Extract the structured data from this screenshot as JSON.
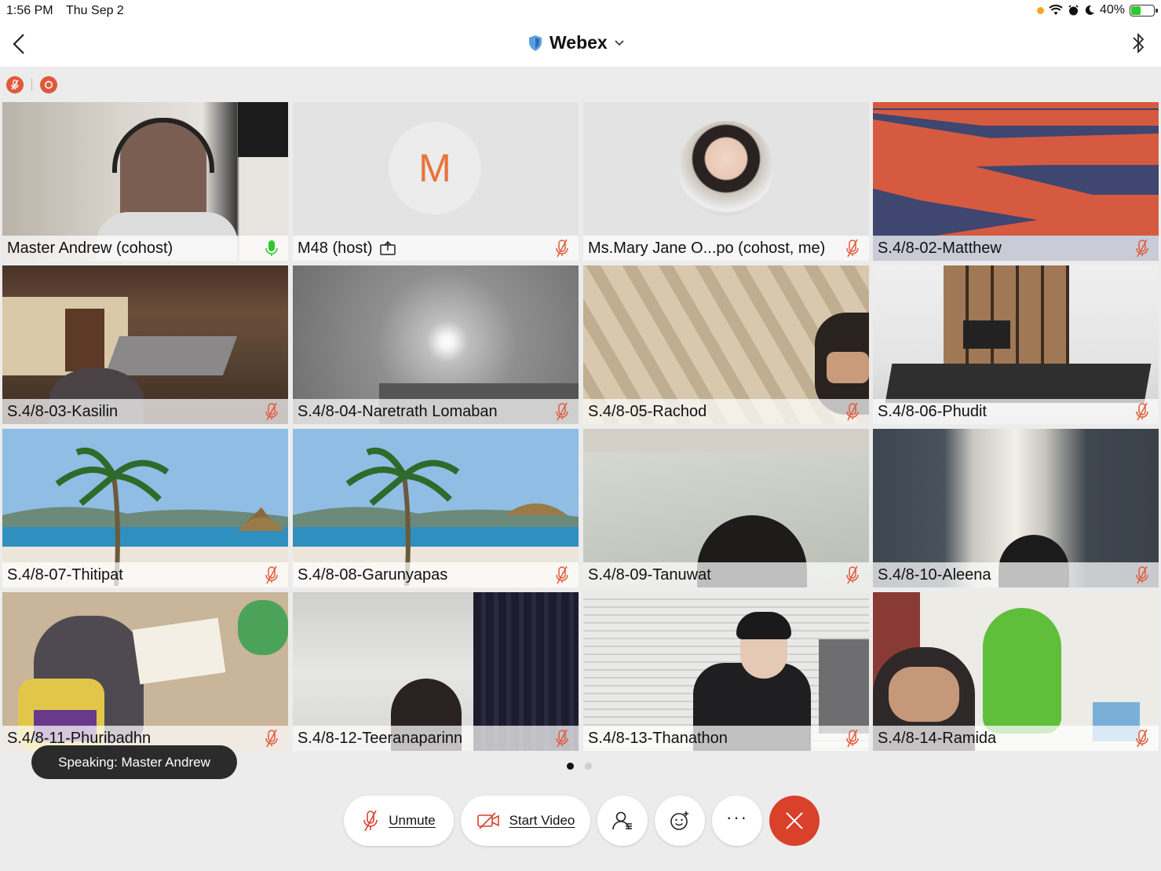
{
  "status_bar": {
    "time": "1:56 PM",
    "date": "Thu Sep 2",
    "battery": "40%"
  },
  "nav": {
    "title": "Webex",
    "back_icon": "chevron-left-icon",
    "right_icon": "bluetooth-icon"
  },
  "recording": {
    "icons": [
      "muted-indicator-icon",
      "recording-icon"
    ]
  },
  "participants": [
    {
      "name": "Master Andrew (cohost)",
      "mic": "active",
      "active": true
    },
    {
      "name": "M48 (host)",
      "mic": "muted",
      "initial": "M",
      "sharing": true
    },
    {
      "name": "Ms.Mary Jane O...po (cohost, me)",
      "mic": "muted"
    },
    {
      "name": "S.4/8-02-Matthew",
      "mic": "muted"
    },
    {
      "name": "S.4/8-03-Kasilin",
      "mic": "muted"
    },
    {
      "name": "S.4/8-04-Naretrath Lomaban",
      "mic": "muted"
    },
    {
      "name": "S.4/8-05-Rachod",
      "mic": "muted"
    },
    {
      "name": "S.4/8-06-Phudit",
      "mic": "muted"
    },
    {
      "name": "S.4/8-07-Thitipat",
      "mic": "muted"
    },
    {
      "name": "S.4/8-08-Garunyapas",
      "mic": "muted"
    },
    {
      "name": "S.4/8-09-Tanuwat",
      "mic": "muted"
    },
    {
      "name": "S.4/8-10-Aleena",
      "mic": "muted"
    },
    {
      "name": "S.4/8-11-Phuribadhn",
      "mic": "muted"
    },
    {
      "name": "S.4/8-12-Teeranaparinn",
      "mic": "muted"
    },
    {
      "name": "S.4/8-13-Thanathon",
      "mic": "muted"
    },
    {
      "name": "S.4/8-14-Ramida",
      "mic": "muted"
    }
  ],
  "speaking_toast": "Speaking: Master Andrew",
  "pager": {
    "pages": 2,
    "current": 1
  },
  "controls": {
    "unmute_label": "Unmute",
    "start_video_label": "Start Video",
    "participants_icon": "participants-icon",
    "reactions_icon": "emoji-icon",
    "more_icon": "more-icon",
    "end_icon": "leave-meeting-icon"
  },
  "colors": {
    "accent_red": "#d9412b",
    "active_border": "#2d6fb3",
    "mic_muted": "#e05a3a",
    "mic_active": "#2ec82e"
  }
}
